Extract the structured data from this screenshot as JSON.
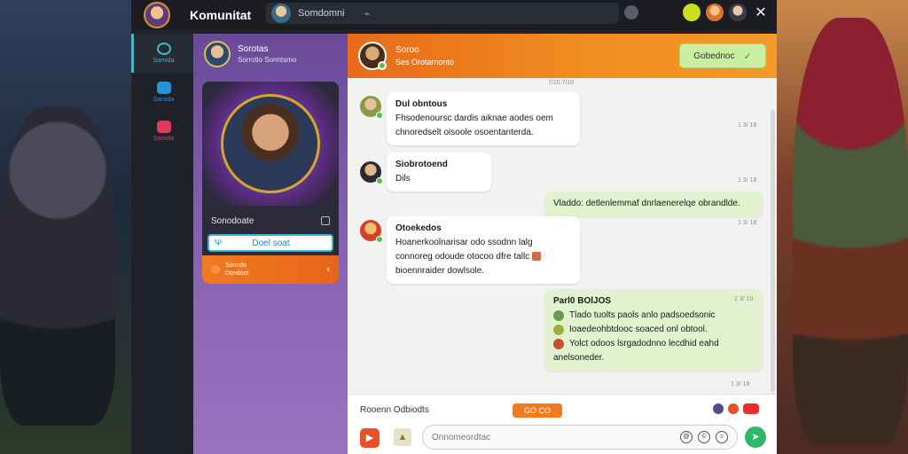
{
  "app": {
    "title": "Komunitat"
  },
  "titlebar": {
    "search_user": "Somdomni",
    "search_icon": "activity-icon",
    "right_icons": [
      "notification-icon",
      "friends-icon",
      "profile-icon"
    ],
    "close_label": "✕"
  },
  "nav": {
    "items": [
      {
        "label": "Samida",
        "color": "#3fb8c8",
        "icon": "compass-icon",
        "active": true
      },
      {
        "label": "Samida",
        "color": "#2a90d8",
        "icon": "chat-icon",
        "active": false
      },
      {
        "label": "Samida",
        "color": "#e03a5a",
        "icon": "gamepad-icon",
        "active": false
      }
    ]
  },
  "panel": {
    "user_name": "Sorotas",
    "user_sub": "Sorrotlo Sonntsmo",
    "card_name": "Sonodoate",
    "card_button": "Doel soat",
    "card_button_icon": "Ψ",
    "status_line1": "Sonndo",
    "status_line2": "Dondoot",
    "status_chevron": "‹"
  },
  "chat": {
    "header_name": "Soroo",
    "header_sub": "Ses Orotarnonto",
    "header_button": "Gobednoc",
    "header_button_icon": "✓",
    "top_time": "7/10 7/10",
    "messages": [
      {
        "name": "Dul obntous",
        "lines": [
          "Fhsodenoursc dardis aiknae aodes oem",
          "chnoredselt oisoole osoentanterda."
        ],
        "time": "1 3/ 18"
      },
      {
        "name": "Siobrotoend",
        "lines": [
          "Dils"
        ],
        "time": "1 3/ 18"
      },
      {
        "outgoing": true,
        "lines": [
          "Vladdo: detlenlemmaf dnrlaenerelqe obrandlde."
        ],
        "time": "1 3/ 18"
      },
      {
        "name": "Otoekedos",
        "lines": [
          "Hoanerkoolnarisar odo ssodnn lalg",
          "connoreg odoude otocoo dfre tallc",
          "bioennraider dowlsole."
        ],
        "time": "1 3/ 18"
      },
      {
        "outgoing": true,
        "title": "Parl0 BOlJOS",
        "rows": [
          "Tlado tuolts paols anlo padsoedsonic",
          "Ioaedeohbtdooc soaced onl obtool.",
          "Yolct odoos lsrgadodnno lecdhid eahd"
        ],
        "tail": "anelsoneder.",
        "time": "2 3/ 10"
      }
    ],
    "bottom_time": "1 3/ 18",
    "typing_label": "Rooenn Odbiodts",
    "typing_badge": "GO CO",
    "input_placeholder": "Onnomeordtac",
    "input_icons": [
      "@",
      "©",
      "☺"
    ],
    "attach_icon": "▶",
    "gif_icon": "▲",
    "send_icon": "➤"
  }
}
